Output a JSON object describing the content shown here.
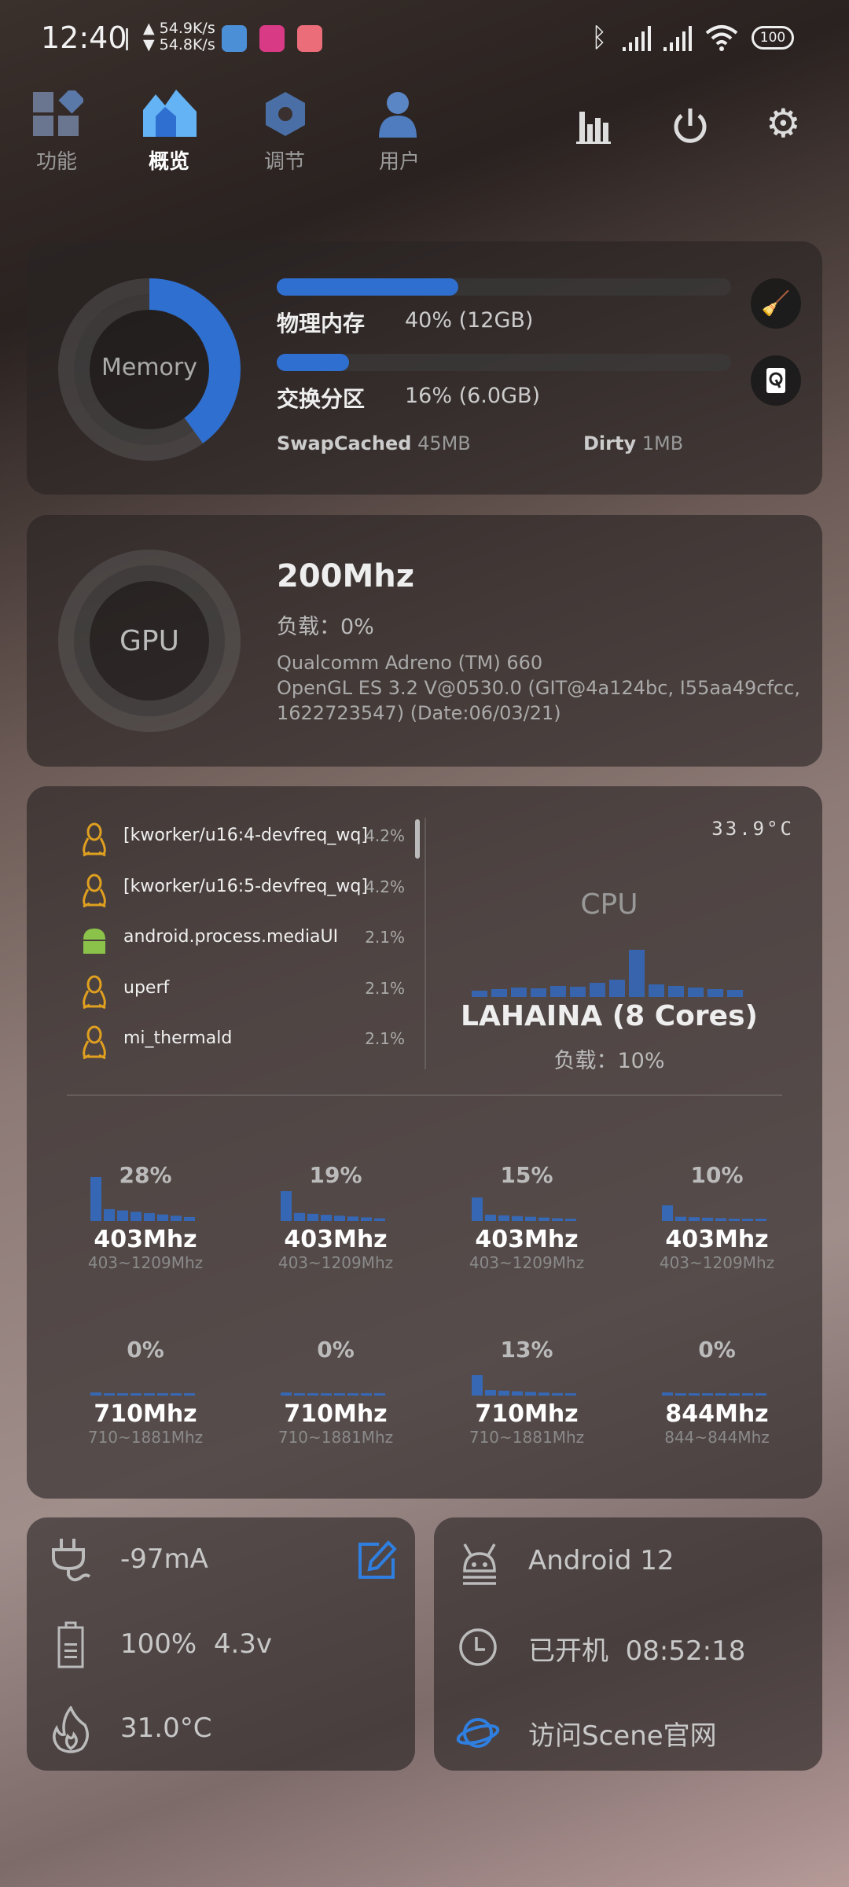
{
  "status_bar": {
    "time": "12:40",
    "net_up": "54.9K/s",
    "net_down": "54.8K/s",
    "battery": "100",
    "icons": [
      "bluetooth-icon",
      "signal-icon",
      "signal-icon",
      "wifi-icon",
      "battery-icon"
    ]
  },
  "tabs": [
    {
      "label": "功能",
      "icon": "grid-icon"
    },
    {
      "label": "概览",
      "icon": "home-icon",
      "active": true
    },
    {
      "label": "调节",
      "icon": "tune-icon"
    },
    {
      "label": "用户",
      "icon": "user-icon"
    }
  ],
  "toolbar_icons": [
    "chart-icon",
    "power-icon",
    "gear-icon"
  ],
  "accent": "#2f6fd0",
  "memory": {
    "ring_label": "Memory",
    "ring_percent": 40,
    "physical": {
      "label": "物理内存",
      "value": "40% (12GB)",
      "percent": 40
    },
    "swap": {
      "label": "交换分区",
      "value": "16% (6.0GB)",
      "percent": 16
    },
    "swap_cached": {
      "label": "SwapCached",
      "value": "45MB"
    },
    "dirty": {
      "label": "Dirty",
      "value": "1MB"
    }
  },
  "gpu": {
    "ring_label": "GPU",
    "ring_percent": 0,
    "freq": "200Mhz",
    "load": "负载：0%",
    "renderer": "Qualcomm Adreno (TM) 660",
    "version_line1": "OpenGL ES 3.2 V@0530.0 (GIT@4a124bc, I55aa49cfcc,",
    "version_line2": "1622723547) (Date:06/03/21)"
  },
  "processes": [
    {
      "name": "[kworker/u16:4-devfreq_wq]",
      "pct": "4.2%",
      "icon": "linux-icon"
    },
    {
      "name": "[kworker/u16:5-devfreq_wq]",
      "pct": "4.2%",
      "icon": "linux-icon"
    },
    {
      "name": "android.process.mediaUI",
      "pct": "2.1%",
      "icon": "android-icon"
    },
    {
      "name": "uperf",
      "pct": "2.1%",
      "icon": "linux-icon"
    },
    {
      "name": "mi_thermald",
      "pct": "2.1%",
      "icon": "linux-icon"
    }
  ],
  "cpu": {
    "temp": "33.9°C",
    "label": "CPU",
    "name": "LAHAINA (8 Cores)",
    "load": "负载：10%"
  },
  "cores": [
    {
      "pct": "28%",
      "freq": "403Mhz",
      "range": "403~1209Mhz"
    },
    {
      "pct": "19%",
      "freq": "403Mhz",
      "range": "403~1209Mhz"
    },
    {
      "pct": "15%",
      "freq": "403Mhz",
      "range": "403~1209Mhz"
    },
    {
      "pct": "10%",
      "freq": "403Mhz",
      "range": "403~1209Mhz"
    },
    {
      "pct": "0%",
      "freq": "710Mhz",
      "range": "710~1881Mhz"
    },
    {
      "pct": "0%",
      "freq": "710Mhz",
      "range": "710~1881Mhz"
    },
    {
      "pct": "13%",
      "freq": "710Mhz",
      "range": "710~1881Mhz"
    },
    {
      "pct": "0%",
      "freq": "844Mhz",
      "range": "844~844Mhz"
    }
  ],
  "battery": {
    "current": "-97mA",
    "level": "100%",
    "voltage": "4.3v",
    "temp": "31.0°C"
  },
  "system": {
    "android": "Android 12",
    "uptime_label": "已开机",
    "uptime": "08:52:18",
    "website": "访问Scene官网"
  }
}
